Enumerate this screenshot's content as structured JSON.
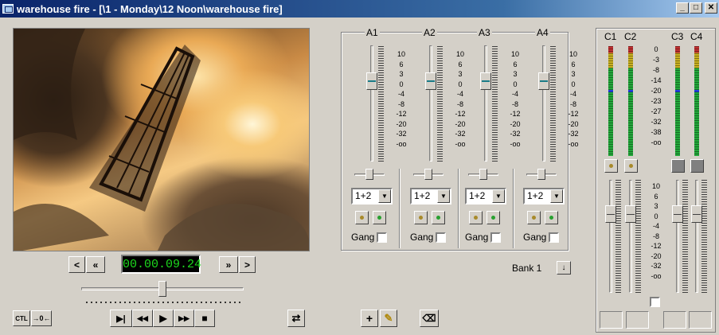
{
  "window": {
    "title": "warehouse fire - [\\1 - Monday\\12 Noon\\warehouse fire]",
    "min_label": "_",
    "max_label": "□",
    "close_label": "✕"
  },
  "transport": {
    "timecode": "00.00.09.24",
    "prev_label": "<",
    "rew_label": "«",
    "ffwd_label": "»",
    "next_label": ">",
    "ctl_label": "CTL",
    "trim_label": "→0←",
    "position_fraction": 0.5,
    "buttons": {
      "play_step": "▶|",
      "rewind": "◀◀",
      "play": "▶",
      "fast_forward": "▶▶",
      "stop": "■"
    },
    "loop_icon": "⇄",
    "marker_label": "+",
    "pen_label": "✎",
    "eraser_label": "⌫"
  },
  "audio_channels": [
    {
      "name": "A1",
      "route": "1+2",
      "gang_label": "Gang"
    },
    {
      "name": "A2",
      "route": "1+2",
      "gang_label": "Gang"
    },
    {
      "name": "A3",
      "route": "1+2",
      "gang_label": "Gang"
    },
    {
      "name": "A4",
      "route": "1+2",
      "gang_label": "Gang"
    }
  ],
  "fader_scale": [
    "10",
    "6",
    "3",
    "0",
    "-4",
    "-8",
    "-12",
    "-20",
    "-32",
    "-oo"
  ],
  "bank": {
    "label": "Bank 1",
    "arrow": "↓"
  },
  "output_channels": [
    "C1",
    "C2",
    "C3",
    "C4"
  ],
  "meter_scale": [
    "0",
    "-3",
    "-8",
    "-14",
    "-20",
    "-23",
    "-27",
    "-32",
    "-38",
    "-oo"
  ],
  "output_fader_scale": [
    "10",
    "6",
    "3",
    "0",
    "-4",
    "-8",
    "-12",
    "-20",
    "-32",
    "-oo"
  ],
  "colors": {
    "titlebar_start": "#0a246a",
    "timecode": "#1dd81d",
    "meter_green": "#22a83a",
    "meter_yellow": "#c8b020",
    "meter_red": "#c03030",
    "meter_blue": "#2040e0"
  }
}
